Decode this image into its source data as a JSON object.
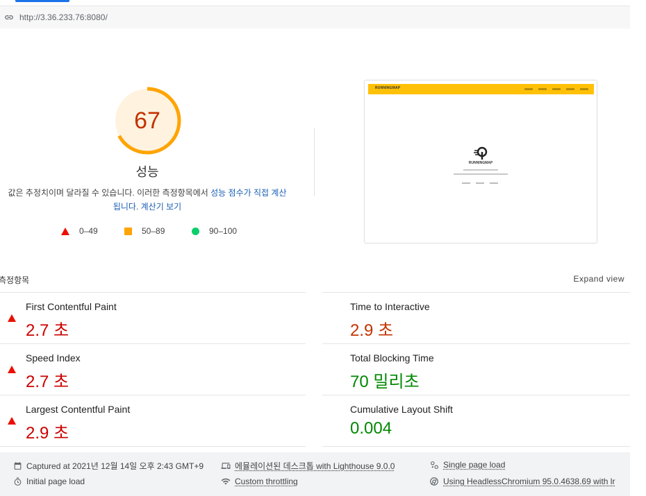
{
  "browser": {
    "url": "http://3.36.233.76:8080/"
  },
  "gauge": {
    "score": "67",
    "label": "성능",
    "score_fraction": 0.67,
    "color": "#ffa400"
  },
  "description": {
    "text_before": "값은 추정치이며 달라질 수 있습니다. 이러한 측정항목에서 ",
    "link1": "성능 점수가 직접 계산됩니다",
    "text_mid": ". ",
    "link2": "계산기 보기"
  },
  "legend": [
    {
      "range": "0–49",
      "shape": "triangle",
      "color": "#eb0f00"
    },
    {
      "range": "50–89",
      "shape": "square",
      "color": "#ffa400"
    },
    {
      "range": "90–100",
      "shape": "circle",
      "color": "#0cce6b"
    }
  ],
  "thumbnail": {
    "logo_text": "RUNNINGMAP",
    "brand": "RUNNINGMAP"
  },
  "metrics_section": {
    "title": "측정항목",
    "expand_label": "Expand view"
  },
  "metrics": [
    {
      "name": "First Contentful Paint",
      "value": "2.7 초",
      "rating": "fail"
    },
    {
      "name": "Time to Interactive",
      "value": "2.9 초",
      "rating": "average"
    },
    {
      "name": "Speed Index",
      "value": "2.7 초",
      "rating": "fail"
    },
    {
      "name": "Total Blocking Time",
      "value": "70 밀리초",
      "rating": "pass"
    },
    {
      "name": "Largest Contentful Paint",
      "value": "2.9 초",
      "rating": "fail"
    },
    {
      "name": "Cumulative Layout Shift",
      "value": "0.004",
      "rating": "pass"
    }
  ],
  "footer": {
    "captured": "Captured at 2021년 12월 14일 오후 2:43 GMT+9",
    "emulated": "에뮬레이션된 데스크톱 with Lighthouse 9.0.0",
    "single_load": "Single page load",
    "initial_load": "Initial page load",
    "throttling": "Custom throttling",
    "browser": "Using HeadlessChromium 95.0.4638.69 with lr"
  }
}
